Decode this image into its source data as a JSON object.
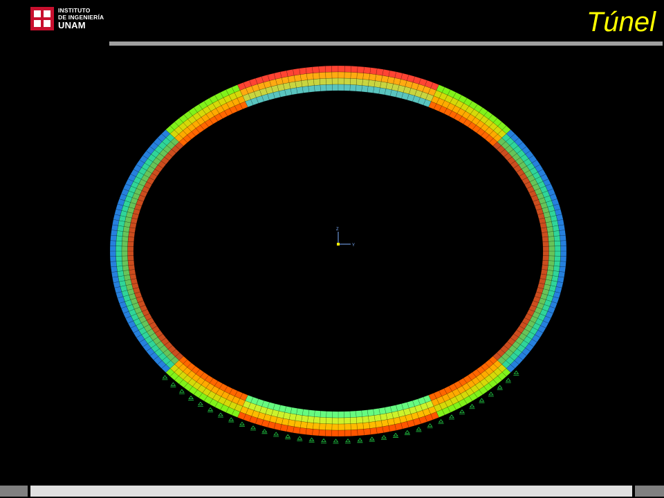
{
  "header": {
    "logo": {
      "line1": "INSTITUTO",
      "line2": "DE INGENIERÍA",
      "line3": "UNAM",
      "brand_color": "#c8102e"
    },
    "title": "Túnel",
    "title_color": "#ffff00"
  },
  "viewport": {
    "triad": {
      "vertical_label": "Z",
      "horizontal_label": "Y"
    },
    "colors": {
      "background": "#000000",
      "contour_scale": [
        "#ff0000",
        "#ff8800",
        "#ffee00",
        "#66ff00",
        "#00ffaa",
        "#00ccff",
        "#0044ff",
        "#ff00ff"
      ]
    }
  },
  "footer": {
    "segment_colors": [
      "#808080",
      "#e0e0e0",
      "#808080"
    ]
  }
}
